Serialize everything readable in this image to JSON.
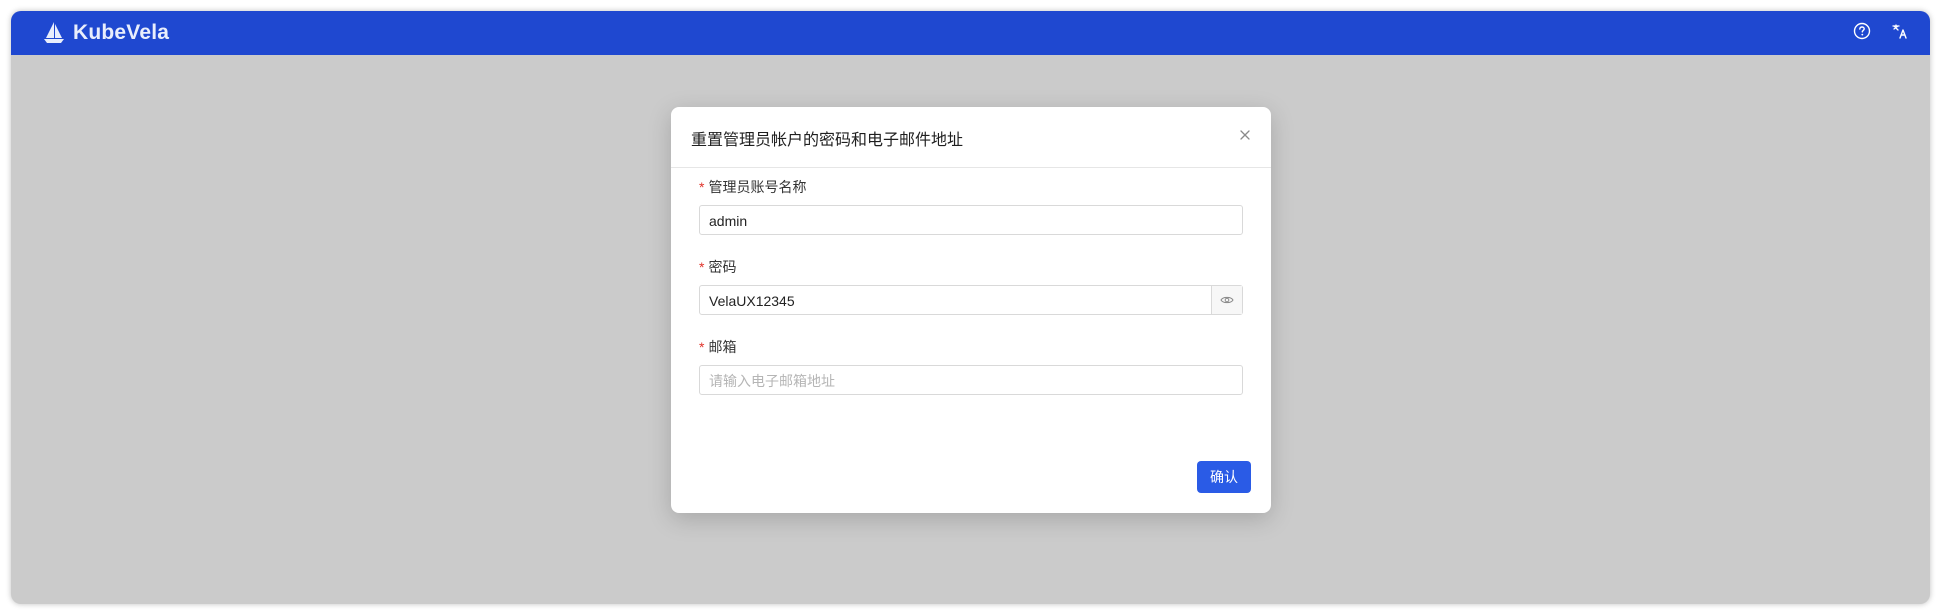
{
  "app": {
    "brand": "KubeVela"
  },
  "header": {
    "icons": [
      "help-icon",
      "translate-icon"
    ]
  },
  "modal": {
    "title": "重置管理员帐户的密码和电子邮件地址",
    "username": {
      "label": "管理员账号名称",
      "value": "admin"
    },
    "password": {
      "label": "密码",
      "value": "VelaUX12345"
    },
    "email": {
      "label": "邮箱",
      "value": "",
      "placeholder": "请输入电子邮箱地址"
    },
    "required_mark": "*",
    "confirm_label": "确认"
  },
  "colors": {
    "topbar": "#1f48d0",
    "primary_button": "#2a5be6",
    "required": "#e0332a",
    "overlay": "#cbcbcb"
  }
}
